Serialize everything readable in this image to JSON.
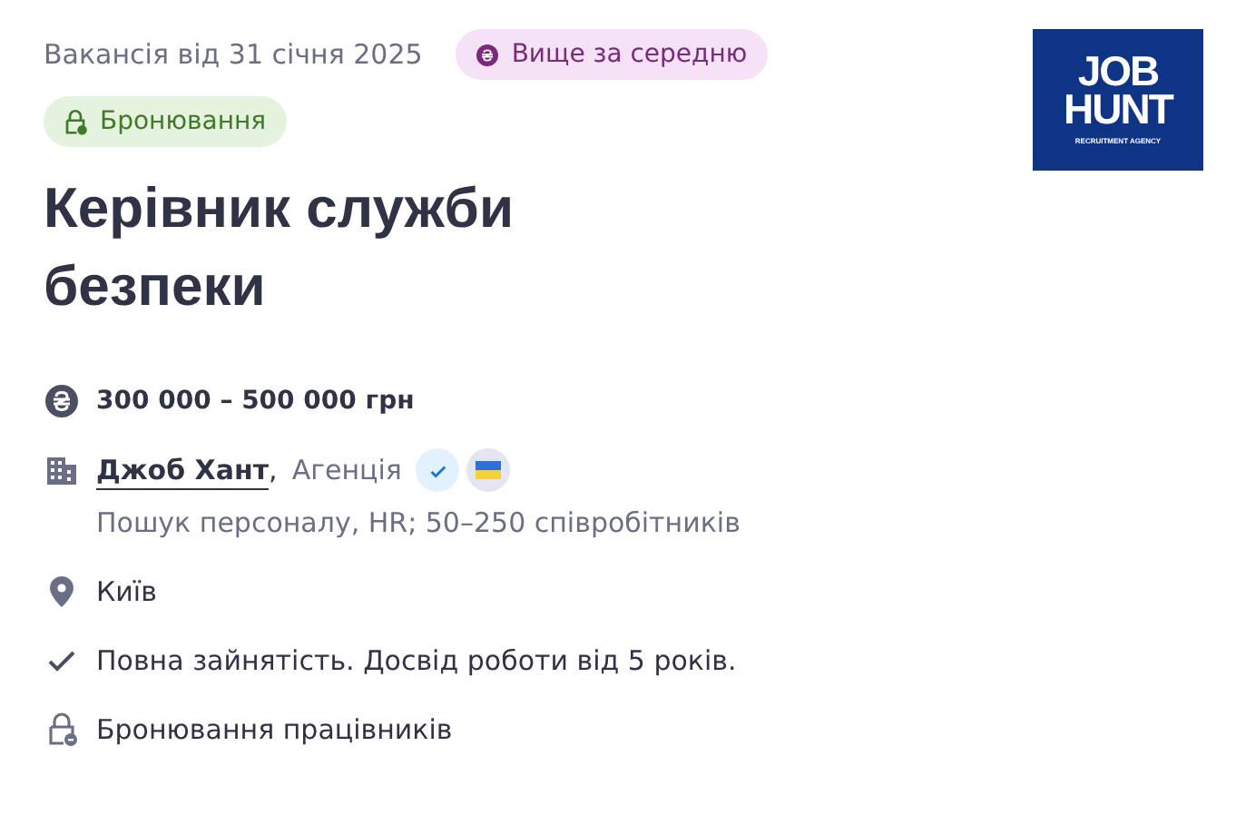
{
  "header": {
    "date": "Вакансія від 31 січня 2025",
    "salary_badge": "Вище за середню",
    "booking_badge": "Бронювання"
  },
  "logo": {
    "lines": [
      "JOB",
      "HUNT"
    ],
    "tagline": "RECRUITMENT AGENCY"
  },
  "title": "Керівник служби безпеки",
  "details": [
    {
      "kind": "salary",
      "text": "300 000 – 500 000 грн"
    },
    {
      "kind": "company",
      "name": "Джоб Хант",
      "separator": ",",
      "type": "Агенція",
      "verified": true,
      "ukrainian": true,
      "note": "Пошук персоналу, HR; 50–250 співробітників"
    },
    {
      "kind": "location",
      "text": "Київ"
    },
    {
      "kind": "check",
      "text": "Повна зайнятість. Досвід роботи від 5 років."
    },
    {
      "kind": "lock",
      "text": "Бронювання працівників"
    }
  ]
}
